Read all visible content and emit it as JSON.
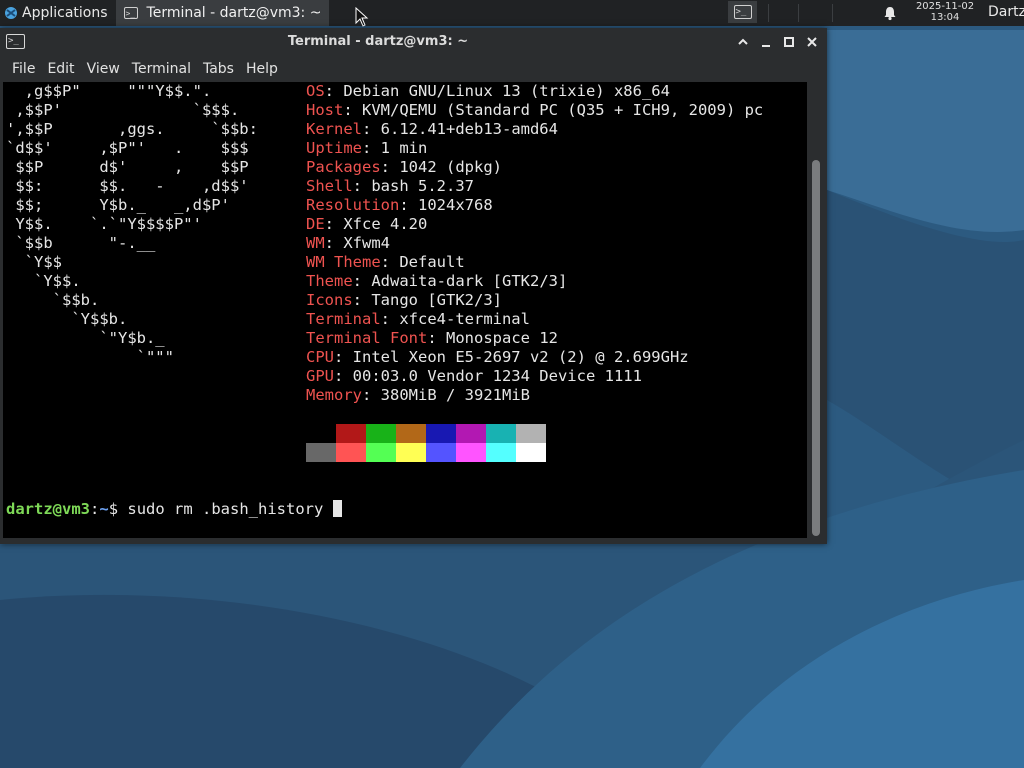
{
  "panel": {
    "applications_label": "Applications",
    "applications_icon": "xfce-mouse-icon",
    "task_title": "Terminal - dartz@vm3: ~",
    "clock_date": "2025-11-02",
    "clock_time": "13:04",
    "user_label": "Dartz"
  },
  "window": {
    "title": "Terminal - dartz@vm3: ~",
    "menu": [
      "File",
      "Edit",
      "View",
      "Terminal",
      "Tabs",
      "Help"
    ]
  },
  "terminal": {
    "logo_lines": [
      "  ,g$$P\"     \"\"\"Y$$.\".",
      " ,$$P'              `$$$.",
      "',$$P       ,ggs.     `$$b:",
      "`d$$'     ,$P\"'   .    $$$",
      " $$P      d$'     ,    $$P",
      " $$:      $$.   -    ,d$$'",
      " $$;      Y$b._   _,d$P'",
      " Y$$.    `.`\"Y$$$$P\"'",
      " `$$b      \"-.__",
      "  `Y$$",
      "   `Y$$.",
      "     `$$b.",
      "       `Y$$b.",
      "          `\"Y$b._",
      "              `\"\"\""
    ],
    "info": [
      {
        "label": "OS",
        "value": "Debian GNU/Linux 13 (trixie) x86_64"
      },
      {
        "label": "Host",
        "value": "KVM/QEMU (Standard PC (Q35 + ICH9, 2009) pc"
      },
      {
        "label": "Kernel",
        "value": "6.12.41+deb13-amd64"
      },
      {
        "label": "Uptime",
        "value": "1 min"
      },
      {
        "label": "Packages",
        "value": "1042 (dpkg)"
      },
      {
        "label": "Shell",
        "value": "bash 5.2.37"
      },
      {
        "label": "Resolution",
        "value": "1024x768"
      },
      {
        "label": "DE",
        "value": "Xfce 4.20"
      },
      {
        "label": "WM",
        "value": "Xfwm4"
      },
      {
        "label": "WM Theme",
        "value": "Default"
      },
      {
        "label": "Theme",
        "value": "Adwaita-dark [GTK2/3]"
      },
      {
        "label": "Icons",
        "value": "Tango [GTK2/3]"
      },
      {
        "label": "Terminal",
        "value": "xfce4-terminal"
      },
      {
        "label": "Terminal Font",
        "value": "Monospace 12"
      },
      {
        "label": "CPU",
        "value": "Intel Xeon E5-2697 v2 (2) @ 2.699GHz"
      },
      {
        "label": "GPU",
        "value": "00:03.0 Vendor 1234 Device 1111"
      },
      {
        "label": "Memory",
        "value": "380MiB / 3921MiB"
      }
    ],
    "separator": ": ",
    "palette_normal": [
      "#000000",
      "#b21818",
      "#18b218",
      "#b26818",
      "#1818b2",
      "#b218b2",
      "#18b2b2",
      "#b2b2b2"
    ],
    "palette_bright": [
      "#686868",
      "#ff5454",
      "#54ff54",
      "#ffff54",
      "#5454ff",
      "#ff54ff",
      "#54ffff",
      "#ffffff"
    ],
    "prompt_user": "dartz@vm3",
    "prompt_colon": ":",
    "prompt_path": "~",
    "prompt_symbol": "$",
    "command": " sudo rm .bash_history "
  },
  "colors": {
    "label": "#ef5350",
    "prompt_user": "#7ed957",
    "prompt_path": "#6ca0ef"
  }
}
